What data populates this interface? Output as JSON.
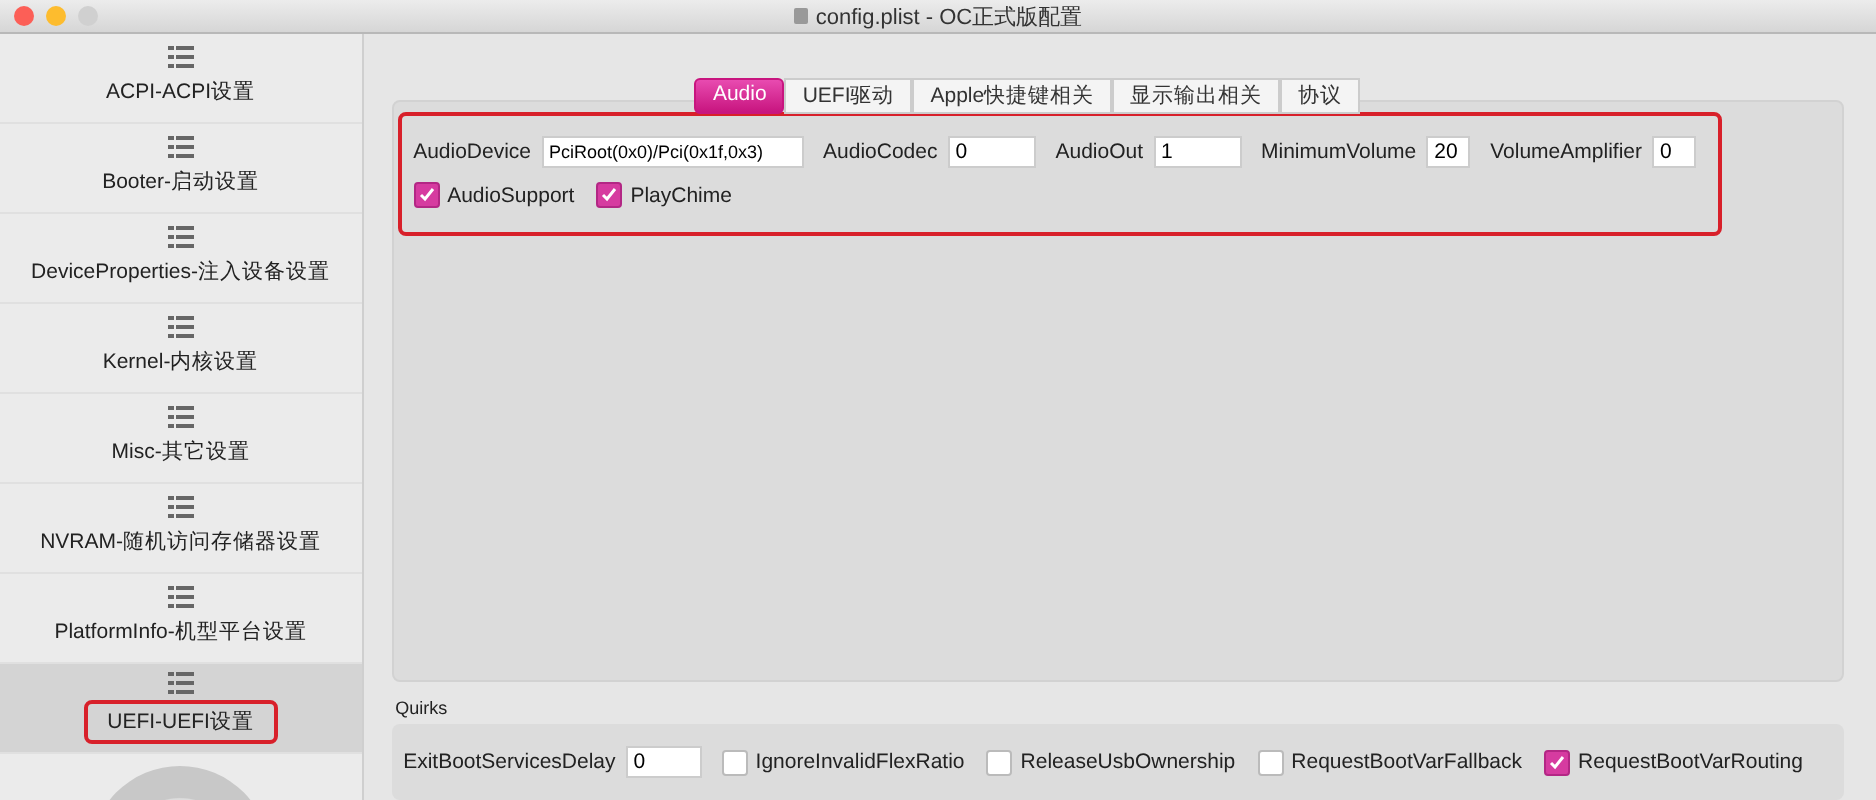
{
  "window": {
    "title": "config.plist - OC正式版配置"
  },
  "sidebar": {
    "items": [
      {
        "label": "ACPI-ACPI设置",
        "selected": false
      },
      {
        "label": "Booter-启动设置",
        "selected": false
      },
      {
        "label": "DeviceProperties-注入设备设置",
        "selected": false
      },
      {
        "label": "Kernel-内核设置",
        "selected": false
      },
      {
        "label": "Misc-其它设置",
        "selected": false
      },
      {
        "label": "NVRAM-随机访问存储器设置",
        "selected": false
      },
      {
        "label": "PlatformInfo-机型平台设置",
        "selected": false
      },
      {
        "label": "UEFI-UEFI设置",
        "selected": true
      }
    ]
  },
  "tabs": [
    {
      "label": "Audio",
      "selected": true
    },
    {
      "label": "UEFI驱动",
      "selected": false
    },
    {
      "label": "Apple快捷键相关",
      "selected": false
    },
    {
      "label": "显示输出相关",
      "selected": false
    },
    {
      "label": "协议",
      "selected": false
    }
  ],
  "audio": {
    "fields": [
      {
        "label": "AudioDevice",
        "value": "PciRoot(0x0)/Pci(0x1f,0x3)",
        "kind": "wide"
      },
      {
        "label": "AudioCodec",
        "value": "0",
        "kind": "medium"
      },
      {
        "label": "AudioOut",
        "value": "1",
        "kind": "medium"
      },
      {
        "label": "MinimumVolume",
        "value": "20",
        "kind": "small"
      },
      {
        "label": "VolumeAmplifier",
        "value": "0",
        "kind": "small"
      }
    ],
    "checkboxes": [
      {
        "label": "AudioSupport",
        "checked": true
      },
      {
        "label": "PlayChime",
        "checked": true
      }
    ]
  },
  "quirks": {
    "title": "Quirks",
    "items": [
      {
        "kind": "field",
        "label": "ExitBootServicesDelay",
        "value": "0"
      },
      {
        "kind": "checkbox",
        "label": "IgnoreInvalidFlexRatio",
        "checked": false
      },
      {
        "kind": "checkbox",
        "label": "ReleaseUsbOwnership",
        "checked": false
      },
      {
        "kind": "checkbox",
        "label": "RequestBootVarFallback",
        "checked": false
      },
      {
        "kind": "checkbox",
        "label": "RequestBootVarRouting",
        "checked": true
      }
    ]
  }
}
